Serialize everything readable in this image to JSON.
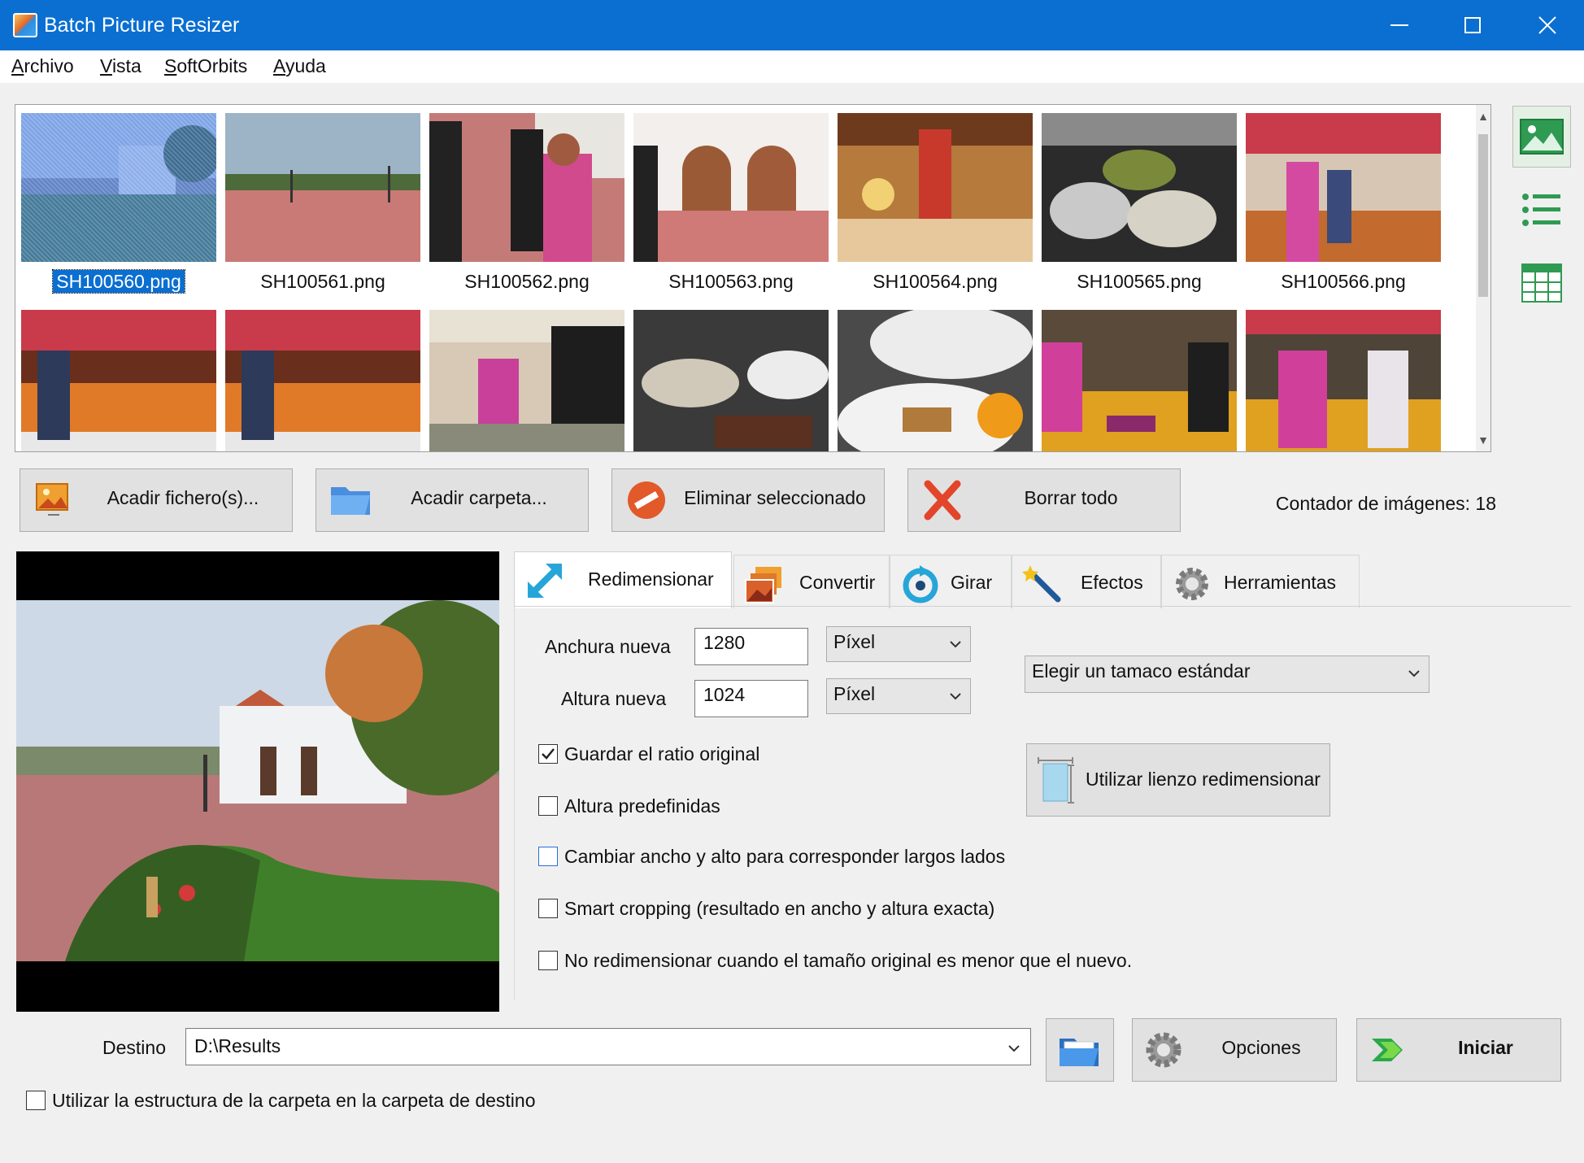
{
  "window": {
    "title": "Batch Picture Resizer"
  },
  "menu": [
    "Archivo",
    "Vista",
    "SoftOrbits",
    "Ayuda"
  ],
  "thumbnails": [
    {
      "label": "SH100560.png",
      "selected": true
    },
    {
      "label": "SH100561.png",
      "selected": false
    },
    {
      "label": "SH100562.png",
      "selected": false
    },
    {
      "label": "SH100563.png",
      "selected": false
    },
    {
      "label": "SH100564.png",
      "selected": false
    },
    {
      "label": "SH100565.png",
      "selected": false
    },
    {
      "label": "SH100566.png",
      "selected": false
    }
  ],
  "actions": {
    "add_files": "Acadir fichero(s)...",
    "add_folder": "Acadir carpeta...",
    "remove_selected": "Eliminar seleccionado",
    "clear_all": "Borrar todo"
  },
  "counter": "Contador de imágenes: 18",
  "tabs": [
    "Redimensionar",
    "Convertir",
    "Girar",
    "Efectos",
    "Herramientas"
  ],
  "resize": {
    "width_label": "Anchura nueva",
    "width_value": "1280",
    "height_label": "Altura nueva",
    "height_value": "1024",
    "unit_width": "Píxel",
    "unit_height": "Píxel",
    "standard_size": "Elegir un tamaco estándar",
    "canvas_button": "Utilizar lienzo redimensionar",
    "keep_ratio": "Guardar el ratio original",
    "predefined_height": "Altura predefinidas",
    "swap_sides": "Cambiar ancho y alto para corresponder largos lados",
    "smart_crop": "Smart cropping (resultado en ancho y altura exacta)",
    "no_upscale": "No redimensionar cuando el tamaño original es menor que el nuevo."
  },
  "checks": {
    "keep_ratio": true,
    "predefined_height": false,
    "swap_sides": false,
    "smart_crop": false,
    "no_upscale": false,
    "folder_structure": false
  },
  "destination": {
    "label": "Destino",
    "value": "D:\\Results",
    "folder_structure": "Utilizar la estructura de la carpeta en la carpeta de destino"
  },
  "bottom": {
    "options": "Opciones",
    "start": "Iniciar"
  },
  "colors": {
    "titlebar": "#0a6fd1",
    "selection": "#0a6fd1",
    "panel": "#f0f0f0"
  }
}
